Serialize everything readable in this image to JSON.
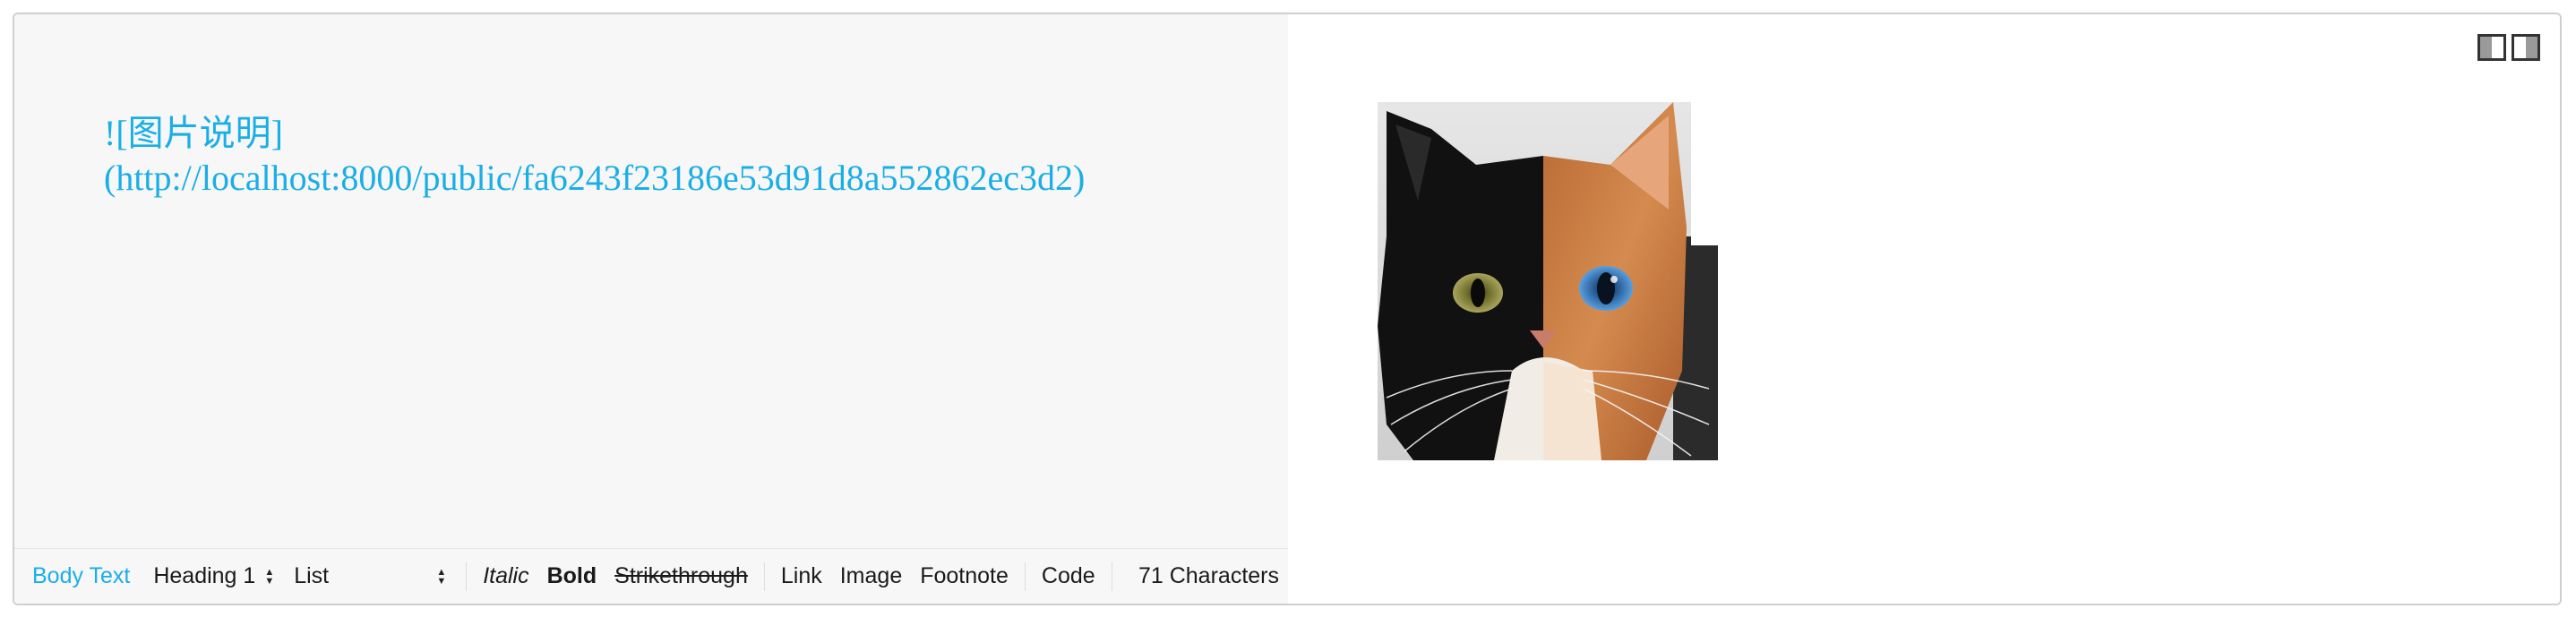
{
  "editor": {
    "markdown_line1": "![图片说明]",
    "markdown_line2": "(http://localhost:8000/public/fa6243f23186e53d91d8a552862ec3d2)"
  },
  "toolbar": {
    "body_text": "Body Text",
    "heading": "Heading 1",
    "list": "List",
    "italic": "Italic",
    "bold": "Bold",
    "strikethrough": "Strikethrough",
    "link": "Link",
    "image": "Image",
    "footnote": "Footnote",
    "code": "Code",
    "char_count": "71 Characters"
  },
  "colors": {
    "accent": "#1aaee7",
    "editor_bg": "#f7f7f7",
    "border": "#cfcfcf"
  },
  "icons": {
    "view_toggle_left": "split-view-left-icon",
    "view_toggle_right": "split-view-right-icon",
    "preview_image": "two-faced-cat-image"
  }
}
